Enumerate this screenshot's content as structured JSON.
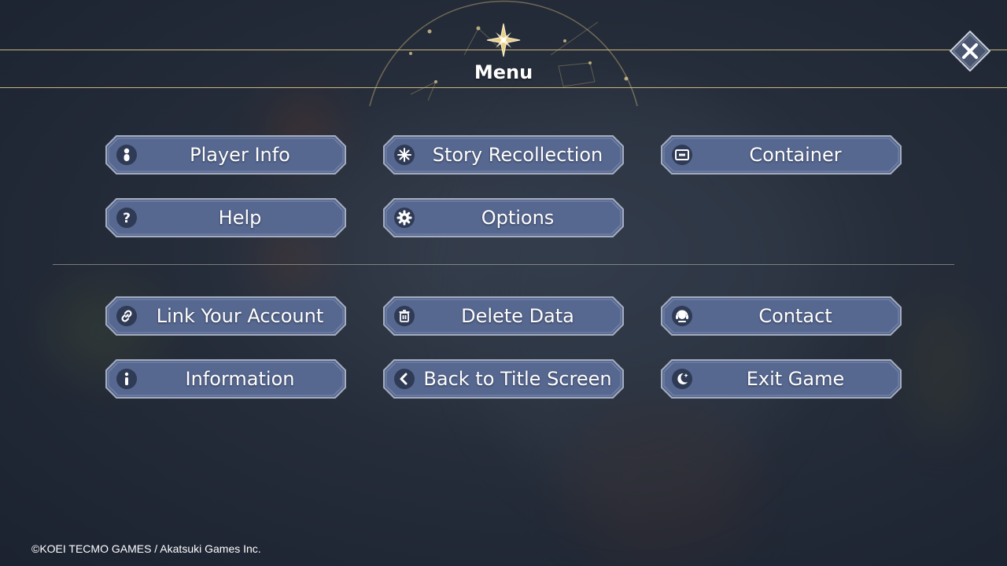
{
  "header": {
    "title": "Menu",
    "emblem_icon": "compass-star-icon",
    "close_icon": "close-icon"
  },
  "colors": {
    "accent_gold": "#c9b67a",
    "button_fill": "#5a6b8f",
    "button_border": "#9aa3b5",
    "icon_circle": "#2f3a55"
  },
  "menu": {
    "row1": [
      {
        "label": "Player Info",
        "icon": "player-info-icon"
      },
      {
        "label": "Story Recollection",
        "icon": "sparkle-icon"
      },
      {
        "label": "Container",
        "icon": "container-icon"
      }
    ],
    "row2": [
      {
        "label": "Help",
        "icon": "question-icon"
      },
      {
        "label": "Options",
        "icon": "gear-icon"
      }
    ],
    "row3": [
      {
        "label": "Link Your Account",
        "icon": "link-icon"
      },
      {
        "label": "Delete Data",
        "icon": "trash-icon"
      },
      {
        "label": "Contact",
        "icon": "support-headset-icon"
      }
    ],
    "row4": [
      {
        "label": "Information",
        "icon": "info-icon"
      },
      {
        "label": "Back to Title Screen",
        "icon": "back-arrow-icon"
      },
      {
        "label": "Exit Game",
        "icon": "moon-icon"
      }
    ]
  },
  "footer": {
    "copyright": "©KOEI TECMO GAMES / Akatsuki Games Inc."
  }
}
